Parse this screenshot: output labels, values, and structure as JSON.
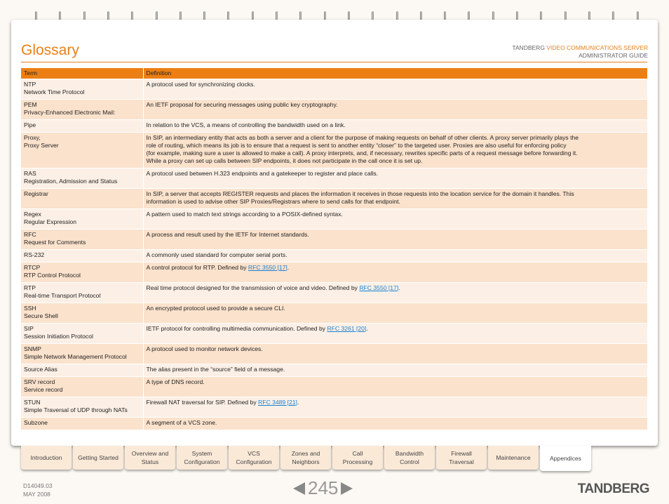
{
  "header": {
    "title": "Glossary",
    "brand": "TANDBERG",
    "product": "VIDEO COMMUNICATIONS SERVER",
    "guide": "ADMINISTRATOR GUIDE"
  },
  "table": {
    "columns": [
      "Term",
      "Definition"
    ],
    "rows": [
      {
        "term": [
          "NTP",
          "Network Time Protocol"
        ],
        "def": [
          "A protocol used for synchronizing clocks."
        ]
      },
      {
        "term": [
          "PEM",
          "Privacy-Enhanced Electronic Mail:"
        ],
        "def": [
          "An IETF proposal for securing messages using public key cryptography."
        ]
      },
      {
        "term": [
          "Pipe"
        ],
        "def": [
          "In relation to the VCS, a means of controlling the bandwidth used on a link."
        ]
      },
      {
        "term": [
          "Proxy,",
          "Proxy Server"
        ],
        "def": [
          "In SIP, an intermediary entity that acts as both a server and a client for the purpose of making requests on behalf of other clients.  A proxy server primarily plays the",
          "role of routing, which means its job is to ensure that a request is sent to another entity “closer” to the targeted user.  Proxies are also useful for enforcing policy",
          "(for example, making sure a user is allowed to make a call).  A proxy interprets, and, if necessary, rewrites specific parts of a request message before forwarding it.",
          "While a proxy can set up calls between SIP endpoints, it does not participate in the call once it is set up."
        ]
      },
      {
        "term": [
          "RAS",
          "Registration, Admission and Status"
        ],
        "def": [
          "A protocol used between H.323 endpoints and a gatekeeper to register and place calls."
        ]
      },
      {
        "term": [
          "Registrar"
        ],
        "def": [
          "In SIP, a server that accepts REGISTER requests and places the information it receives in those requests into the location service for the domain it handles.  This",
          "information is used to advise other SIP Proxies/Registrars where to send calls for that endpoint."
        ]
      },
      {
        "term": [
          "Regex",
          "Regular Expression"
        ],
        "def": [
          "A pattern used to match text strings according to a POSIX-defined syntax."
        ]
      },
      {
        "term": [
          "RFC",
          "Request for Comments"
        ],
        "def": [
          "A process and result used by the IETF for Internet standards."
        ]
      },
      {
        "term": [
          "RS-232"
        ],
        "def": [
          "A commonly used standard for computer serial ports."
        ]
      },
      {
        "term": [
          "RTCP",
          "RTP Control Protocol"
        ],
        "def": [
          "A control protocol for RTP. Defined by "
        ],
        "link": "RFC 3550 [17]",
        "after": "."
      },
      {
        "term": [
          "RTP",
          "Real-time Transport Protocol"
        ],
        "def": [
          "Real time protocol designed for the transmission of voice and video. Defined by "
        ],
        "link": "RFC 3550 [17]",
        "after": "."
      },
      {
        "term": [
          "SSH",
          "Secure Shell"
        ],
        "def": [
          "An encrypted protocol used to provide a secure CLI."
        ]
      },
      {
        "term": [
          "SIP",
          "Session Initiation Protocol"
        ],
        "def": [
          "IETF protocol for controlling multimedia communication.  Defined by "
        ],
        "link": "RFC 3261 [20]",
        "after": "."
      },
      {
        "term": [
          "SNMP",
          "Simple Network Management Protocol"
        ],
        "def": [
          "A protocol used to monitor network devices."
        ]
      },
      {
        "term": [
          "Source Alias"
        ],
        "def": [
          "The alias present in the “source” field of a message."
        ]
      },
      {
        "term": [
          "SRV record",
          "Service record"
        ],
        "def": [
          "A type of DNS record."
        ]
      },
      {
        "term": [
          "STUN",
          "Simple Traversal of UDP through NATs"
        ],
        "def": [
          "Firewall NAT traversal for SIP. Defined by "
        ],
        "link": "RFC 3489 [21]",
        "after": "."
      },
      {
        "term": [
          "Subzone"
        ],
        "def": [
          "A segment of a VCS zone."
        ]
      }
    ]
  },
  "tabs": [
    [
      "Introduction"
    ],
    [
      "Getting Started"
    ],
    [
      "Overview and",
      "Status"
    ],
    [
      "System",
      "Configuration"
    ],
    [
      "VCS",
      "Configuration"
    ],
    [
      "Zones and",
      "Neighbors"
    ],
    [
      "Call",
      "Processing"
    ],
    [
      "Bandwidth",
      "Control"
    ],
    [
      "Firewall",
      "Traversal"
    ],
    [
      "Maintenance"
    ],
    [
      "Appendices"
    ]
  ],
  "active_tab": "Appendices",
  "footer": {
    "doc_id": "D14049.03",
    "date": "MAY 2008",
    "page": "245",
    "logo": "TANDBERG"
  },
  "colors": {
    "accent": "#ec7f14",
    "row_light": "#fcf0e6",
    "row_dark": "#fbe2cc",
    "link": "#1a7fd0"
  }
}
